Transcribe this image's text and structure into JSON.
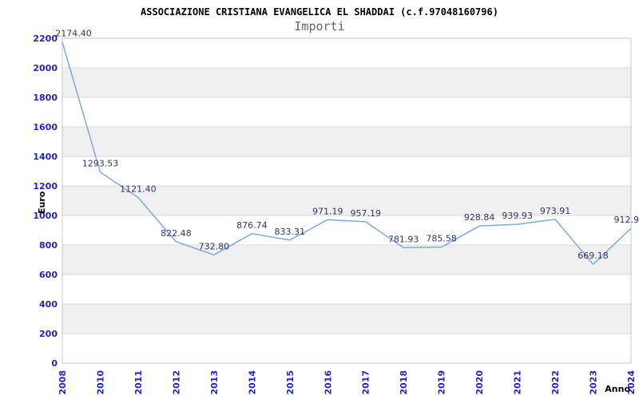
{
  "chart_data": {
    "type": "line",
    "title": "ASSOCIAZIONE CRISTIANA EVANGELICA EL SHADDAI (c.f.97048160796)",
    "subtitle": "Importi",
    "xlabel": "Anno",
    "ylabel": "Euro",
    "categories": [
      "2008",
      "2010",
      "2011",
      "2012",
      "2013",
      "2014",
      "2015",
      "2016",
      "2017",
      "2018",
      "2019",
      "2020",
      "2021",
      "2022",
      "2023",
      "2024"
    ],
    "values": [
      2174.4,
      1293.53,
      1121.4,
      822.48,
      732.8,
      876.74,
      833.31,
      971.19,
      957.19,
      781.93,
      785.58,
      928.84,
      939.93,
      973.91,
      669.18,
      912.9
    ],
    "point_labels": [
      "2174.40",
      "1293.53",
      "1121.40",
      "822.48",
      "732.80",
      "876.74",
      "833.31",
      "971.19",
      "957.19",
      "781.93",
      "785.58",
      "928.84",
      "939.93",
      "973.91",
      "669.18",
      "912.9"
    ],
    "ylim": [
      0,
      2200
    ],
    "yticks": [
      0,
      200,
      400,
      600,
      800,
      1000,
      1200,
      1400,
      1600,
      1800,
      2000,
      2200
    ],
    "grid": "horizontal gridlines with alternating shaded bands",
    "legend": "none",
    "colors": {
      "background": "#ffffff",
      "line": "#7fa9e2",
      "tick_label": "#2222cc",
      "point_label": "#333366",
      "band": "#f0f0f0",
      "gridline": "#dadada",
      "plot_border": "#c4c4c4",
      "title": "#000000",
      "subtitle": "#666666",
      "axis_title": "#000000"
    }
  }
}
